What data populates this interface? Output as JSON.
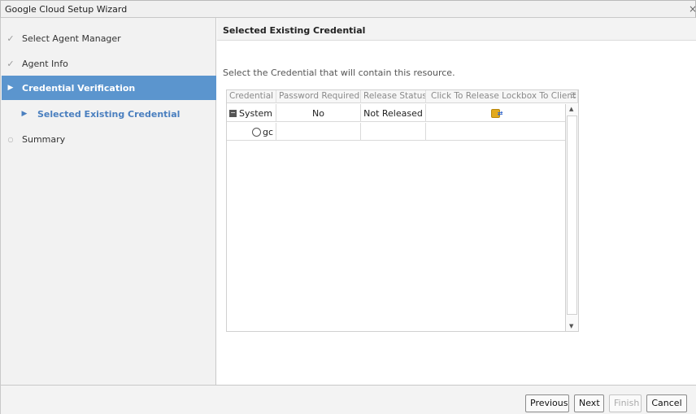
{
  "window": {
    "title": "Google Cloud Setup Wizard",
    "close_glyph": "×"
  },
  "steps": [
    {
      "label": "Select Agent Manager",
      "marker": "✓",
      "state": "done"
    },
    {
      "label": "Agent Info",
      "marker": "✓",
      "state": "done"
    },
    {
      "label": "Credential Verification",
      "marker": "▶",
      "state": "active"
    },
    {
      "label": "Selected Existing Credential",
      "marker": "▶",
      "state": "sub-active"
    },
    {
      "label": "Summary",
      "marker": "○",
      "state": "pending"
    }
  ],
  "panel": {
    "title": "Selected Existing Credential",
    "instruction": "Select the Credential that will contain this resource."
  },
  "grid": {
    "columns": [
      "Credential",
      "Password Required",
      "Release Status",
      "Click To Release Lockbox To Client"
    ],
    "rows": [
      {
        "credential": "System",
        "password_required": "No",
        "release_status": "Not Released",
        "lockbox_icon": "lockbox-release-icon",
        "expand": "collapse"
      },
      {
        "credential": "gc",
        "password_required": "",
        "release_status": "",
        "lockbox_icon": "",
        "expand": "radio"
      }
    ]
  },
  "buttons": {
    "previous": "Previous",
    "next": "Next",
    "finish": "Finish",
    "cancel": "Cancel"
  },
  "colors": {
    "active_step_bg": "#5b95ce",
    "sub_step_text": "#4a7fbf",
    "lockbox_icon": "#e2a91c"
  }
}
